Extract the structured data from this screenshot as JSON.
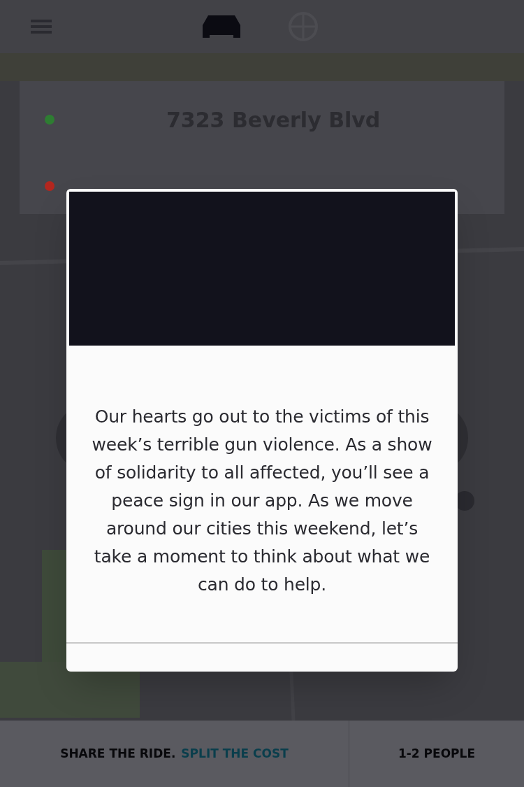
{
  "top_bar": {
    "vehicle_options": [
      {
        "selected": true
      },
      {
        "selected": false
      }
    ]
  },
  "trip": {
    "stops": [
      {
        "color": "#2e7d32",
        "address": "7323 Beverly Blvd"
      },
      {
        "color": "#b3261e"
      }
    ]
  },
  "ride_bar": {
    "prompt": "SHARE THE RIDE.",
    "link": "SPLIT THE COST",
    "seats": "1-2 PEOPLE"
  },
  "dialog": {
    "message": "Our hearts go out to the victims of this week’s terrible gun violence. As a show of solidarity to all affected, you’ll see a peace sign in our app. As we move around our cities this weekend, let’s take a moment to think about what we can do to help."
  }
}
